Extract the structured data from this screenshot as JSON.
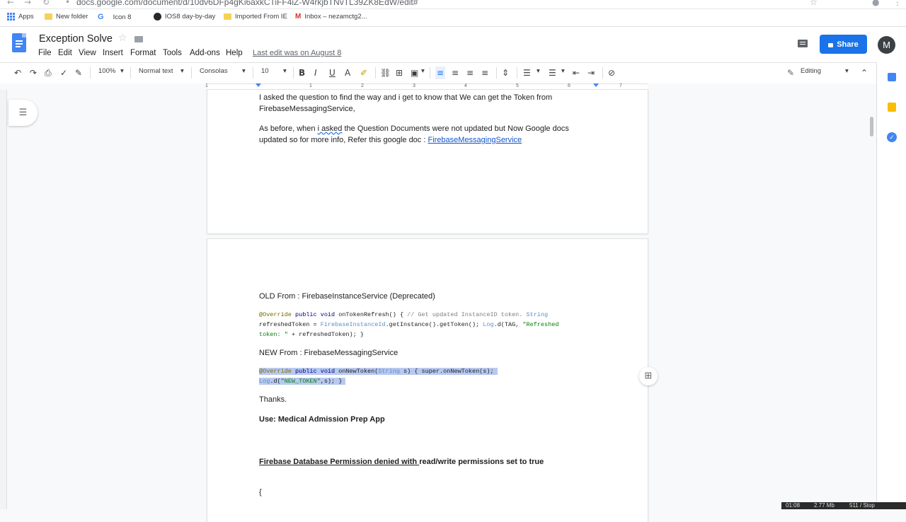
{
  "browser": {
    "url": "docs.google.com/document/d/10dv6DFp4gKi6axkCTiFF4iZ-W4rkjbTNvTL39ZK8EdW/edit#",
    "bookmarks": [
      {
        "label": "Apps",
        "icon": "apps-grid-icon"
      },
      {
        "label": "New folder",
        "icon": "folder-icon"
      },
      {
        "label": "Icon 8",
        "icon": "google-icon"
      },
      {
        "label": "IOS8 day-by-day",
        "icon": "github-icon"
      },
      {
        "label": "Imported From IE",
        "icon": "folder-icon"
      },
      {
        "label": "Inbox – nezamctg2...",
        "icon": "gmail-icon"
      }
    ],
    "avatar_letter": "M"
  },
  "doc": {
    "title": "Exception Solve",
    "menus": [
      "File",
      "Edit",
      "View",
      "Insert",
      "Format",
      "Tools",
      "Add-ons",
      "Help"
    ],
    "last_edit": "Last edit was on August 8",
    "share_label": "Share",
    "avatar_letter": "M"
  },
  "toolbar": {
    "zoom": "100%",
    "style": "Normal text",
    "font": "Consolas",
    "size": "10",
    "mode": "Editing"
  },
  "ruler": {
    "numbers": [
      "1",
      "1",
      "2",
      "3",
      "4",
      "5",
      "6",
      "7"
    ]
  },
  "content": {
    "p1_line1": "I asked the question to find the way and i get to know that We can get the Token from",
    "p1_line2": "FirebaseMessagingService,",
    "p2_line1_a": "As before, when ",
    "p2_line1_b": "i asked",
    "p2_line1_c": " the Question Documents were not updated but Now Google docs",
    "p2_line2_a": "updated so for more info, Refer this google doc : ",
    "p2_link": "FirebaseMessagingService",
    "old_heading": "OLD From : FirebaseInstanceService (Deprecated)",
    "old_code": {
      "l1_a": "@Override",
      "l1_b": " public void ",
      "l1_c": "onTokenRefresh() { ",
      "l1_d": "// Get updated InstanceID token.",
      "l1_e": " String",
      "l2_a": "refreshedToken = ",
      "l2_b": "FirebaseInstanceId",
      "l2_c": ".getInstance().getToken(); ",
      "l2_d": "Log",
      "l2_e": ".d(TAG, ",
      "l2_f": "\"Refreshed",
      "l3_a": "token: \"",
      "l3_b": " + refreshedToken); }"
    },
    "new_heading": "NEW From : FirebaseMessagingService",
    "new_code": {
      "l1_a": "@Override",
      "l1_b": " public void ",
      "l1_c": "onNewToken(",
      "l1_d": "String",
      "l1_e": " s) { super.onNewToken(s);",
      "l2_a": "Log",
      "l2_b": ".d(",
      "l2_c": "\"NEW_TOKEN\"",
      "l2_d": ",s); }"
    },
    "thanks": "Thanks.",
    "use_line": "Use: Medical Admission Prep App",
    "firebase_heading_a": "Firebase Database Permission denied with ",
    "firebase_heading_b": "read/write permissions set to true",
    "brace": "{"
  },
  "statusbar": {
    "time": "01:08",
    "mem": "2.77 Mb",
    "net": "511 / Stop"
  },
  "colors": {
    "share_blue": "#1a73e8",
    "link": "#1155cc",
    "selection": "#b8c9f0"
  }
}
